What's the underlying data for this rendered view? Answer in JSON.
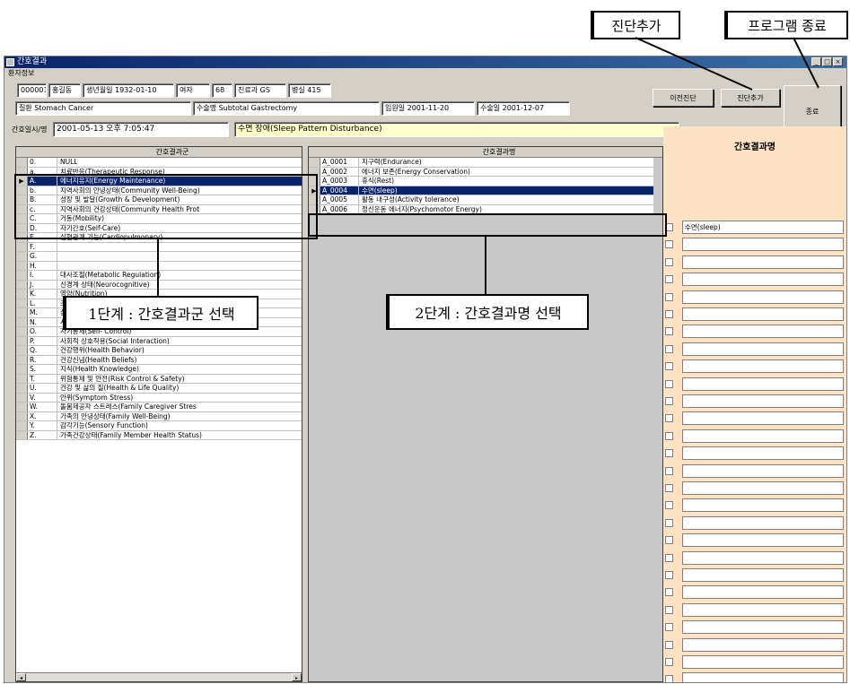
{
  "callouts": {
    "diag_add": "진단추가",
    "program_exit": "프로그램 종료",
    "step1": "1단계 : 간호결과군 선택",
    "step2": "2단계 : 간호결과명 선택"
  },
  "window": {
    "title": "간호결과",
    "menu": "환자정보"
  },
  "patient_info": {
    "row1": [
      "000001",
      "홍길동",
      "생년월일 1932-01-10",
      "여자",
      "68",
      "진료과 GS",
      "병실 415"
    ],
    "diagnosis": "질환 Stomach Cancer",
    "surgery": "수술명 Subtotal Gastrectomy",
    "admit_date": "입원일 2001-11-20",
    "surgery_date": "수술일 2001-12-07",
    "record_label": "간호일시/명",
    "record_datetime": "2001-05-13 오후 7:05:47",
    "nursing_diagnosis": "수면 장애(Sleep Pattern Disturbance)"
  },
  "buttons": {
    "previous": "이전진단",
    "diag_add": "진단추가",
    "exit": "종료"
  },
  "outcome_groups": {
    "header": "간호결과군",
    "selected_index": 2,
    "rows": [
      {
        "code": "0.",
        "name": "NULL"
      },
      {
        "code": "a.",
        "name": "치료반응(Therapeutic Response)"
      },
      {
        "code": "A.",
        "name": "에너지유지(Energy Maintenance)"
      },
      {
        "code": "b.",
        "name": "지역사회의 안녕상태(Community Well-Being)"
      },
      {
        "code": "B.",
        "name": "성장 및 발달(Growth & Development)"
      },
      {
        "code": "c.",
        "name": "지역사회의 건강상태(Community Health Prot"
      },
      {
        "code": "C.",
        "name": "거동(Mobility)"
      },
      {
        "code": "D.",
        "name": "자기간호(Self-Care)"
      },
      {
        "code": "E.",
        "name": "심혈관계 기능(Cardiopulmonary)"
      },
      {
        "code": "F.",
        "name": ""
      },
      {
        "code": "G.",
        "name": ""
      },
      {
        "code": "H.",
        "name": ""
      },
      {
        "code": "I.",
        "name": "대사조절(Metabolic Regulation)"
      },
      {
        "code": "J.",
        "name": "신경계 상태(Neurocognitive)"
      },
      {
        "code": "K.",
        "name": "영양(Nutrition)"
      },
      {
        "code": "L.",
        "name": "조직 통합성(Tissue Integrity)"
      },
      {
        "code": "M.",
        "name": "심리적 안녕상태(Psychological Well-Being)"
      },
      {
        "code": "N.",
        "name": "사회심리적 적응(Psychosocial Adaptation)"
      },
      {
        "code": "O.",
        "name": "자기통제(Self- Control)"
      },
      {
        "code": "P.",
        "name": "사회적 상호작용(Social Interaction)"
      },
      {
        "code": "Q.",
        "name": "건강행위(Health Behavior)"
      },
      {
        "code": "R.",
        "name": "건강신념(Health Beliefs)"
      },
      {
        "code": "S.",
        "name": "지식(Health Knowledge)"
      },
      {
        "code": "T.",
        "name": "위험통제 및 안전(Risk Control & Safety)"
      },
      {
        "code": "U.",
        "name": "건강 및 삶의 질(Health & Life Quality)"
      },
      {
        "code": "V.",
        "name": "안위(Symptom Stress)"
      },
      {
        "code": "W.",
        "name": "돌봄제공자 스트레스(Family Caregiver Stres"
      },
      {
        "code": "X.",
        "name": "가족의 안녕상태(Family Well-Being)"
      },
      {
        "code": "Y.",
        "name": "감각기능(Sensory Function)"
      },
      {
        "code": "Z.",
        "name": "가족건강상태(Family Member Health Status)"
      }
    ]
  },
  "outcome_names": {
    "header": "간호결과명",
    "selected_index": 3,
    "rows": [
      {
        "code": "A_0001",
        "name": "지구력(Endurance)"
      },
      {
        "code": "A_0002",
        "name": "에너지 보존(Energy Conservation)"
      },
      {
        "code": "A_0003",
        "name": "휴식(Rest)"
      },
      {
        "code": "A_0004",
        "name": "수면(sleep)"
      },
      {
        "code": "A_0005",
        "name": "활동 내구성(Activity tolerance)"
      },
      {
        "code": "A_0006",
        "name": "정신운동 에너지(Psychomotor Energy)"
      }
    ]
  },
  "selected_outcomes": {
    "header": "간호결과명",
    "items": [
      "수면(sleep)",
      "",
      "",
      "",
      "",
      "",
      "",
      "",
      "",
      "",
      "",
      "",
      "",
      "",
      "",
      "",
      "",
      "",
      "",
      "",
      "",
      "",
      "",
      "",
      "",
      "",
      ""
    ]
  },
  "colors": {
    "selection": "#0a246a",
    "panel": "#fde2c4",
    "nursing_diagnosis_bg": "#ffffcc",
    "window_bg": "#d4d0c8"
  }
}
